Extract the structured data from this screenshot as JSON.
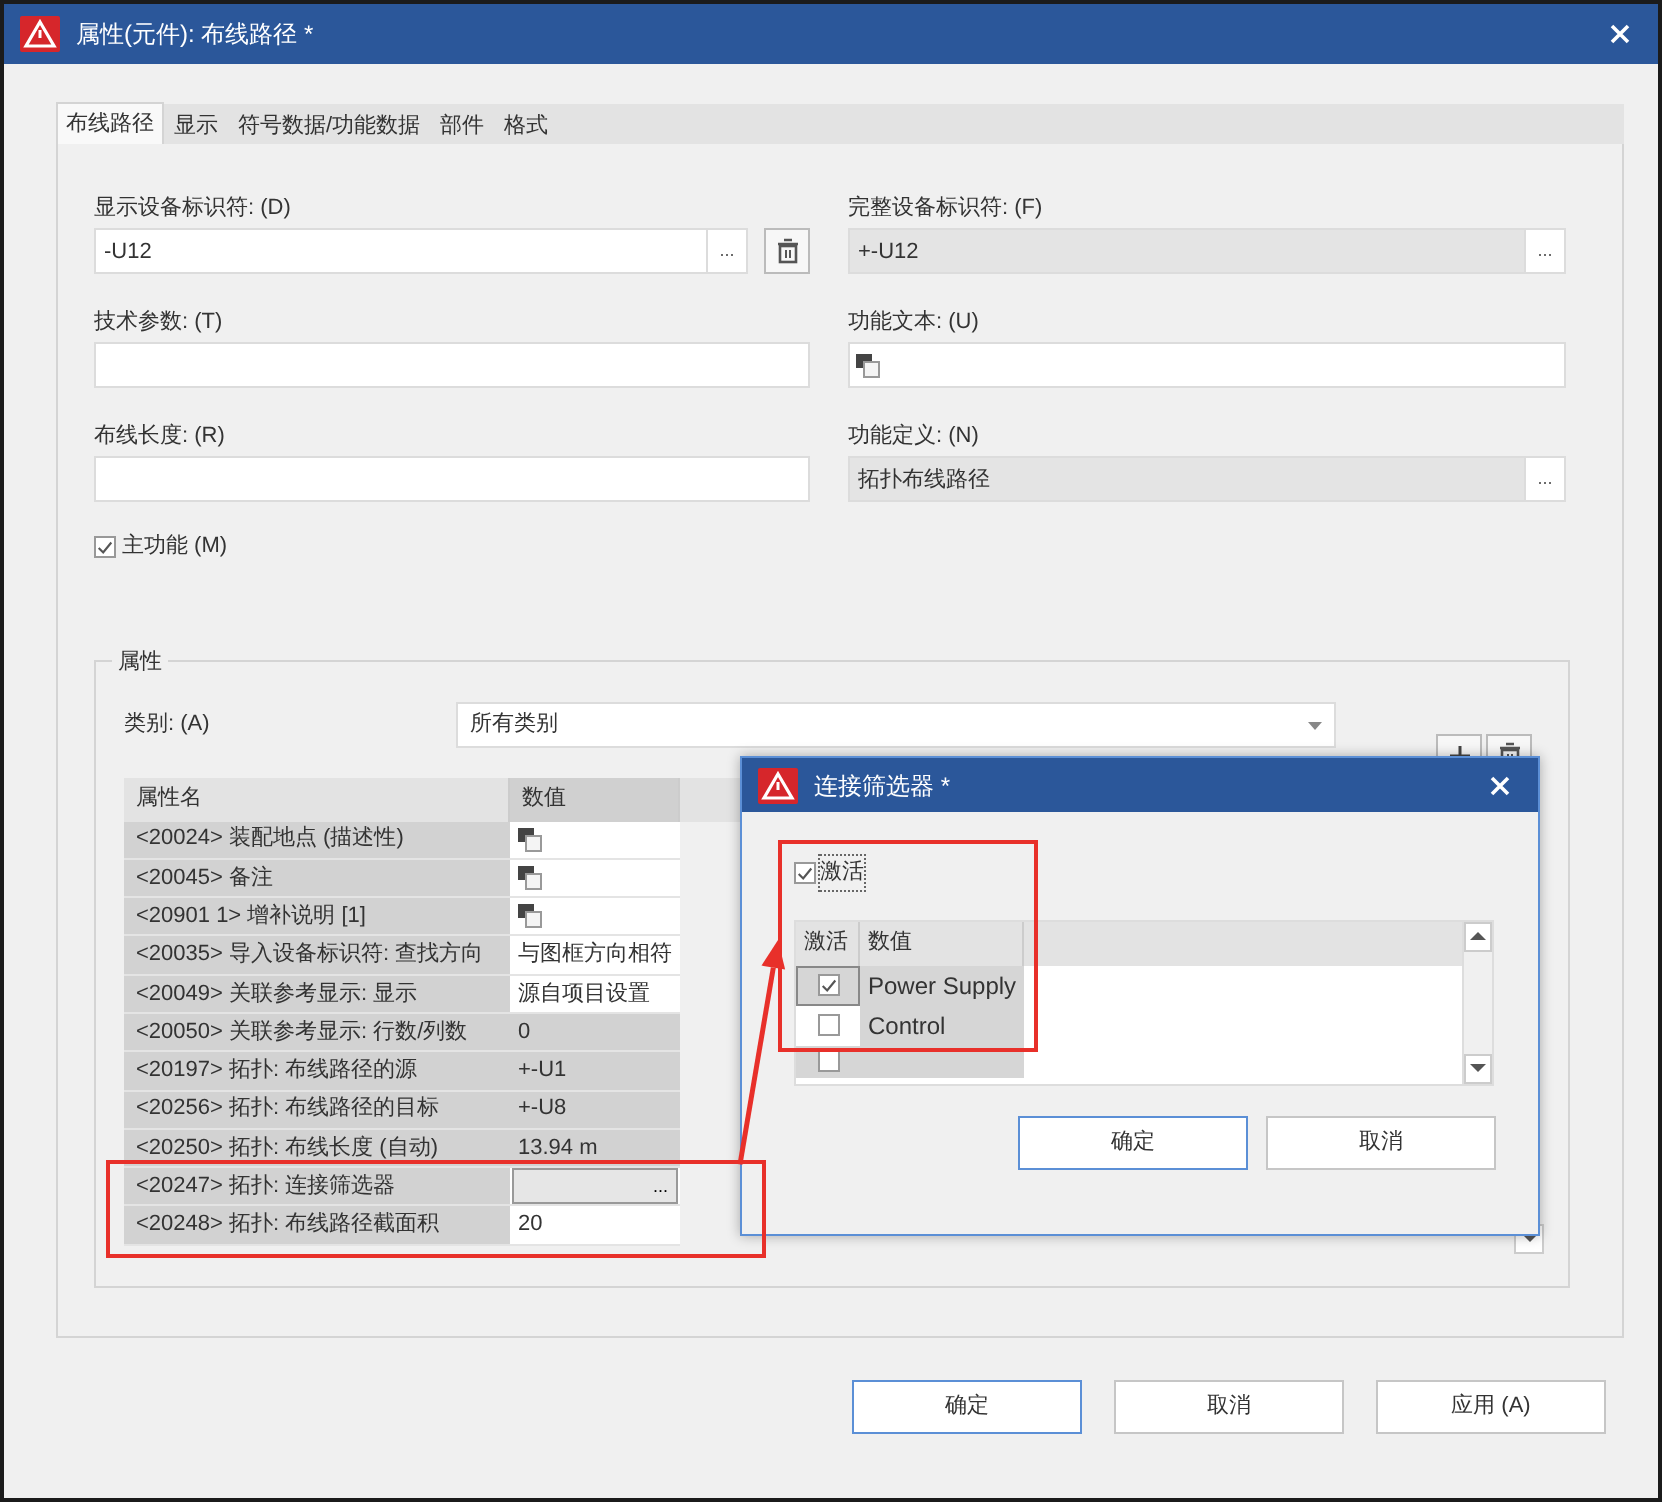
{
  "window": {
    "title": "属性(元件): 布线路径 *"
  },
  "tabs": [
    {
      "label": "布线路径",
      "selected": true
    },
    {
      "label": "显示",
      "selected": false
    },
    {
      "label": "符号数据/功能数据",
      "selected": false
    },
    {
      "label": "部件",
      "selected": false
    },
    {
      "label": "格式",
      "selected": false
    }
  ],
  "left_fields": [
    {
      "label": "显示设备标识符: (D)",
      "kind": "text",
      "value": "-U12",
      "browse": "...",
      "delete": true
    },
    {
      "label": "技术参数: (T)",
      "kind": "text"
    },
    {
      "label": "布线长度: (R)",
      "kind": "text"
    }
  ],
  "right_fields": [
    {
      "label": "完整设备标识符: (F)",
      "kind": "text",
      "value": "+-U12",
      "readonly": true,
      "browse": "..."
    },
    {
      "label": "功能文本: (U)",
      "kind": "multilang"
    },
    {
      "label": "功能定义: (N)",
      "kind": "text",
      "value": "拓扑布线路径",
      "readonly": true,
      "browse": "..."
    }
  ],
  "main_function": {
    "label": "主功能 (M)",
    "checked": true
  },
  "properties": {
    "title": "属性",
    "category_label": "类别: (A)",
    "category_value": "所有类别",
    "columns": [
      "属性名",
      "数值"
    ],
    "rows": [
      {
        "name": "<20024> 装配地点 (描述性)",
        "kind": "multilang",
        "editable": true
      },
      {
        "name": "<20045> 备注",
        "kind": "multilang",
        "editable": true
      },
      {
        "name": "<20901 1> 增补说明 [1]",
        "kind": "multilang",
        "editable": true
      },
      {
        "name": "<20035> 导入设备标识符: 查找方向",
        "kind": "text",
        "value": "与图框方向相符",
        "editable": true
      },
      {
        "name": "<20049> 关联参考显示: 显示",
        "kind": "text",
        "value": "源自项目设置",
        "editable": true
      },
      {
        "name": "<20050> 关联参考显示: 行数/列数",
        "kind": "text",
        "value": "0",
        "editable": false
      },
      {
        "name": "<20197> 拓扑: 布线路径的源",
        "kind": "text",
        "value": "+-U1",
        "editable": false
      },
      {
        "name": "<20256> 拓扑: 布线路径的目标",
        "kind": "text",
        "value": "+-U8",
        "editable": false
      },
      {
        "name": "<20250> 拓扑: 布线长度 (自动)",
        "kind": "text",
        "value": "13.94 m",
        "editable": false
      },
      {
        "name": "<20247> 拓扑: 连接筛选器",
        "kind": "button",
        "value": "...",
        "editable": true,
        "highlighted": true
      },
      {
        "name": "<20248> 拓扑: 布线路径截面积",
        "kind": "text",
        "value": "20",
        "editable": true,
        "highlighted": true
      }
    ]
  },
  "filter_dialog": {
    "title": "连接筛选器 *",
    "active": {
      "label": "激活",
      "checked": true
    },
    "highlighted": true,
    "columns": [
      "激活",
      "数值"
    ],
    "rows": [
      {
        "checked": true,
        "value": "Power Supply",
        "selected": true
      },
      {
        "checked": false,
        "value": "Control",
        "selected": false
      },
      {
        "checked": false,
        "selected": false
      }
    ],
    "buttons": [
      {
        "label": "确定",
        "default": true
      },
      {
        "label": "取消",
        "default": false
      }
    ]
  },
  "buttons": [
    {
      "label": "确定",
      "default": true
    },
    {
      "label": "取消",
      "default": false
    },
    {
      "label": "应用 (A)",
      "default": false
    }
  ]
}
